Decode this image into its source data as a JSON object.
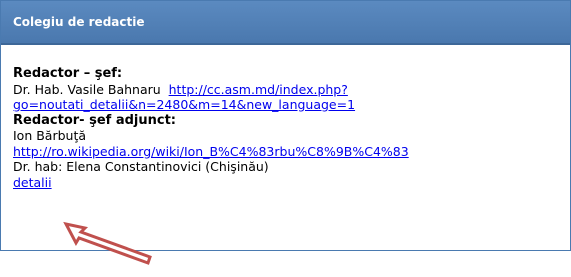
{
  "panel": {
    "title": "Colegiu de redactie"
  },
  "content": {
    "editor_heading": "Redactor – şef:",
    "editor_name": "Dr. Hab. Vasile Bahnaru",
    "editor_link_line1": "http://cc.asm.md/index.php?",
    "editor_link_line2": "go=noutati_detalii&n=2480&m=14&new_language=1",
    "deputy_heading": "Redactor- şef adjunct:",
    "deputy_name": "Ion Bărbuţă",
    "deputy_link": "http://ro.wikipedia.org/wiki/Ion_B%C4%83rbu%C8%9B%C4%83",
    "member_name": "Dr. hab: Elena Constantinovici (Chişinău)",
    "details_link": "detalii"
  },
  "annotation": {
    "arrow_color": "#c0504d",
    "icon": "arrow-pointer-icon"
  }
}
